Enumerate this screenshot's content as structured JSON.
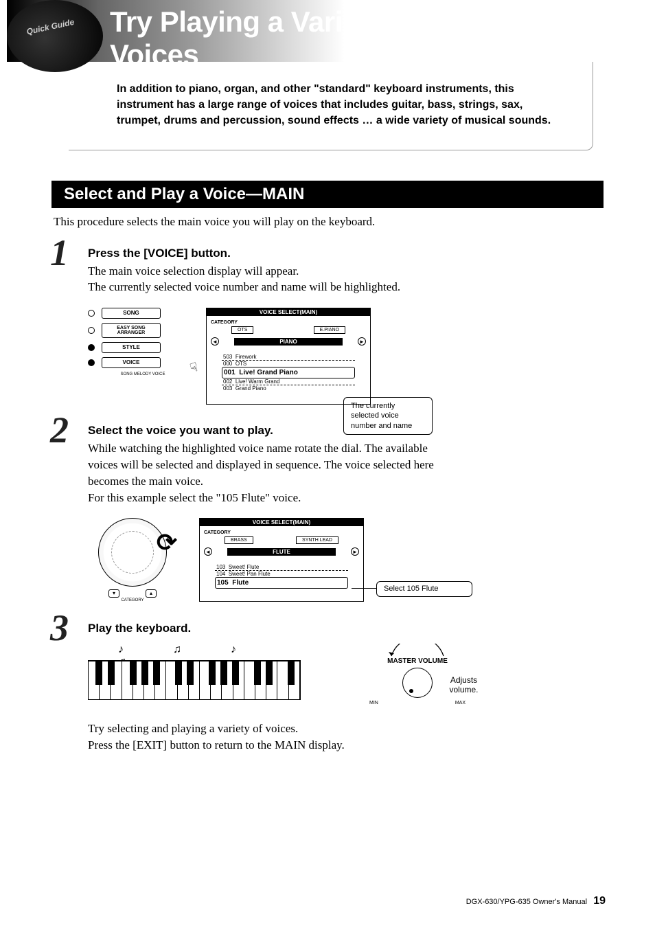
{
  "header": {
    "logo_text": "Quick Guide",
    "title": "Try Playing a Variety of Instrument Voices"
  },
  "intro": "In addition to piano, organ, and other \"standard\" keyboard instruments, this instrument has a large range of voices that includes guitar, bass, strings, sax, trumpet, drums and percussion, sound effects … a wide variety of musical sounds.",
  "section": {
    "heading": "Select and Play a Voice—MAIN",
    "intro": "This procedure selects the main voice you will play on the keyboard."
  },
  "steps": [
    {
      "num": "1",
      "title": "Press the [VOICE] button.",
      "body": "The main voice selection display will appear.\nThe currently selected voice number and name will be highlighted."
    },
    {
      "num": "2",
      "title": "Select the voice you want to play.",
      "body": "While watching the highlighted voice name rotate the dial. The available voices will be selected and displayed in sequence. The voice selected here becomes the main voice.\nFor this example select the \"105 Flute\" voice."
    },
    {
      "num": "3",
      "title": "Play the keyboard.",
      "body": ""
    }
  ],
  "panel": {
    "buttons": [
      "SONG",
      "EASY SONG\nARRANGER",
      "STYLE",
      "VOICE"
    ],
    "caption": "SONG MELODY VOICE"
  },
  "lcd1": {
    "title": "VOICE SELECT(MAIN)",
    "cat_label": "CATEGORY",
    "tab_left": "OTS",
    "tab_right": "E.PIANO",
    "tab_main": "PIANO",
    "list": [
      {
        "id": "503",
        "name": "Firework"
      },
      {
        "id": "000",
        "name": "OTS"
      },
      {
        "id": "001",
        "name": "Live! Grand Piano",
        "selected": true
      },
      {
        "id": "002",
        "name": "Live! Warm Grand"
      },
      {
        "id": "003",
        "name": "Grand Piano"
      }
    ],
    "callout": "The currently selected voice number and name"
  },
  "lcd2": {
    "title": "VOICE SELECT(MAIN)",
    "cat_label": "CATEGORY",
    "tab_left": "BRASS",
    "tab_right": "SYNTH LEAD",
    "tab_main": "FLUTE",
    "list": [
      {
        "id": "103",
        "name": "Sweet! Flute"
      },
      {
        "id": "104",
        "name": "Sweet! Pan Flute"
      },
      {
        "id": "105",
        "name": "Flute",
        "selected": true
      }
    ],
    "callout": "Select 105 Flute"
  },
  "dial": {
    "caption": "CATEGORY"
  },
  "volume": {
    "label": "MASTER VOLUME",
    "min": "MIN",
    "max": "MAX",
    "callout": "Adjusts volume."
  },
  "closing": "Try selecting and playing a variety of voices.\nPress the [EXIT] button to return to the MAIN display.",
  "footer": {
    "text": "DGX-630/YPG-635  Owner's Manual",
    "page": "19"
  }
}
